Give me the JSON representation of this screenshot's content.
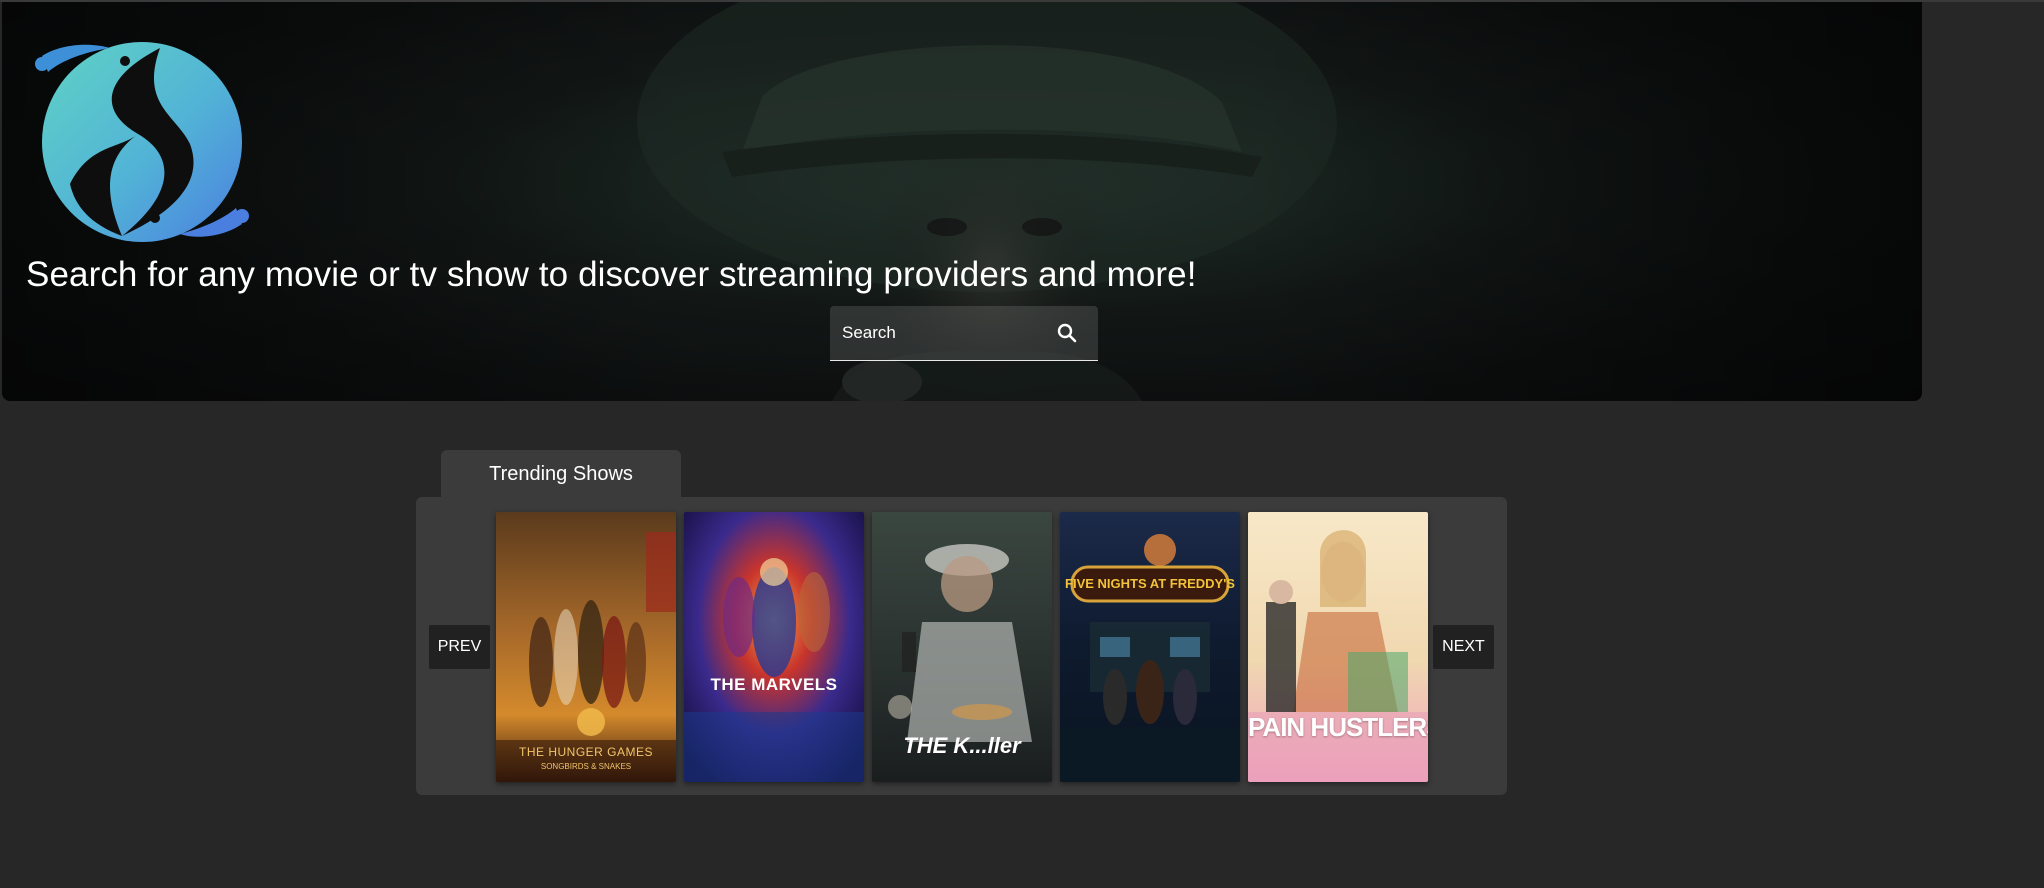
{
  "hero": {
    "headline": "Search for any movie or tv show to discover streaming providers and more!"
  },
  "search": {
    "placeholder": "Search",
    "icon": "search-icon"
  },
  "trending": {
    "tab_label": "Trending Shows",
    "prev_label": "PREV",
    "next_label": "NEXT",
    "posters": [
      {
        "title": "THE HUNGER GAMES",
        "subtitle": "SONGBIRDS & SNAKES"
      },
      {
        "title": "THE MARVELS"
      },
      {
        "title": "THE K...ller"
      },
      {
        "title": "FIVE NIGHTS AT FREDDY'S"
      },
      {
        "title": "PAIN HUSTLERS"
      }
    ]
  },
  "colors": {
    "page_background": "#272727",
    "panel": "#3b3b3b",
    "button": "#212121",
    "logo_teal": "#5fd3c4",
    "logo_blue": "#4a8ee0"
  }
}
